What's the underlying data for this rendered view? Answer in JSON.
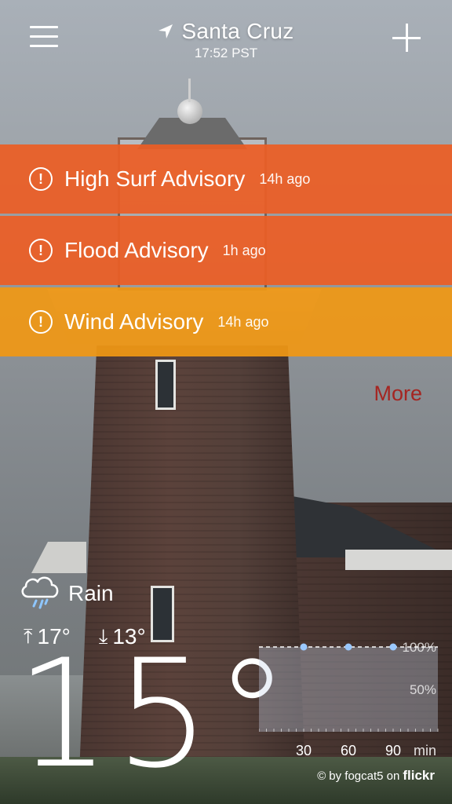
{
  "header": {
    "city": "Santa Cruz",
    "time": "17:52 PST",
    "menu_icon": "hamburger-menu-icon",
    "add_icon": "plus-icon",
    "location_icon": "location-arrow-icon"
  },
  "alerts": [
    {
      "title": "High Surf Advisory",
      "ago": "14h ago",
      "color": "#ec5e25",
      "icon": "alert-circle-icon"
    },
    {
      "title": "Flood Advisory",
      "ago": "1h ago",
      "color": "#ec5e25",
      "icon": "alert-circle-icon"
    },
    {
      "title": "Wind Advisory",
      "ago": "14h ago",
      "color": "#f09814",
      "icon": "alert-circle-icon"
    }
  ],
  "more_label": "More",
  "more_color": "#a52521",
  "conditions": {
    "label": "Rain",
    "icon": "rain-cloud-icon",
    "high": "17°",
    "low": "13°",
    "temp": "15°"
  },
  "chart_data": {
    "type": "area",
    "x": [
      0,
      30,
      60,
      90,
      120
    ],
    "values": [
      100,
      100,
      100,
      100,
      100
    ],
    "markers_x": [
      30,
      60,
      90
    ],
    "x_tick_labels": [
      "30",
      "60",
      "90"
    ],
    "x_unit": "min",
    "y_tick_labels": [
      "100%",
      "50%"
    ],
    "ylim": [
      0,
      100
    ]
  },
  "credit": {
    "prefix": "by fogcat5 on",
    "brand": "flickr",
    "copyright_symbol": "©"
  }
}
